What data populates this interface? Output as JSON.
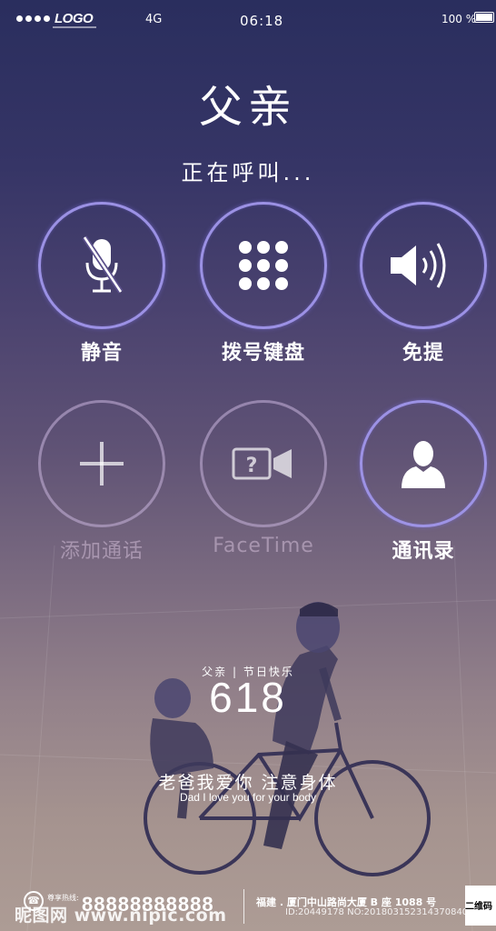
{
  "status_bar": {
    "logo": "LOGO",
    "network": "4G",
    "time": "06:18",
    "battery": "100 %"
  },
  "call": {
    "name": "父亲",
    "status": "正在呼叫..."
  },
  "buttons": {
    "mute": "静音",
    "keypad": "拨号键盘",
    "speaker": "免提",
    "add_call": "添加通话",
    "facetime": "FaceTime",
    "contacts": "通讯录"
  },
  "poster": {
    "festival": "父亲 | 节日快乐",
    "number": "618",
    "slogan_cn": "老爸我爱你 注意身体",
    "slogan_en": "Dad I love you for your body"
  },
  "footer": {
    "hotline_label": "尊享热线:",
    "hotline_number": "88888888888",
    "address": "福建 . 厦门中山路尚大厦 B 座 1088 号",
    "id_code": "ID:20449178 NO:20180315231437084030",
    "qr_label": "二维码",
    "watermark": "昵图网 www.nipic.com"
  },
  "colors": {
    "ring_active": "#a096eb",
    "bg_top": "#2a2e5e",
    "bg_bottom": "#ad9c95"
  }
}
